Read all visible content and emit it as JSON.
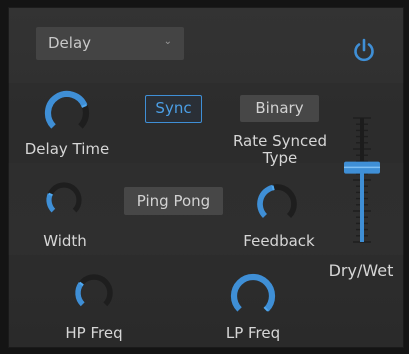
{
  "preset": {
    "value": "Delay",
    "chevron": "⌄"
  },
  "power": {
    "icon": "power-icon",
    "state": "on"
  },
  "controls": {
    "delay_time": {
      "label": "Delay Time",
      "value": 0.75
    },
    "sync": {
      "label": "Sync",
      "active": true
    },
    "binary": {
      "label": "Binary"
    },
    "rate_synced_type": {
      "label_line1": "Rate Synced",
      "label_line2": "Type"
    },
    "width": {
      "label": "Width",
      "value": 0.25
    },
    "ping_pong": {
      "label": "Ping Pong"
    },
    "feedback": {
      "label": "Feedback",
      "value": 0.45
    },
    "dry_wet": {
      "label": "Dry/Wet",
      "value": 0.6
    },
    "hp_freq": {
      "label": "HP Freq",
      "value": 0.3
    },
    "lp_freq": {
      "label": "LP Freq",
      "value": 1.0
    }
  },
  "colors": {
    "accent": "#3f8fd6",
    "knob_track": "#1e1e1e",
    "panel": "#303030"
  }
}
